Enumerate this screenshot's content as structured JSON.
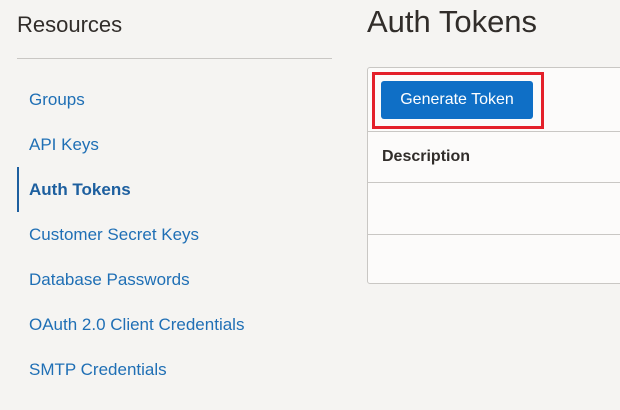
{
  "sidebar": {
    "title": "Resources",
    "items": [
      {
        "label": "Groups"
      },
      {
        "label": "API Keys"
      },
      {
        "label": "Auth Tokens",
        "active": true
      },
      {
        "label": "Customer Secret Keys"
      },
      {
        "label": "Database Passwords"
      },
      {
        "label": "OAuth 2.0 Client Credentials"
      },
      {
        "label": "SMTP Credentials"
      }
    ]
  },
  "main": {
    "title": "Auth Tokens",
    "toolbar": {
      "generate_label": "Generate Token"
    },
    "table": {
      "columns": [
        "Description"
      ],
      "rows": [
        [
          ""
        ],
        [
          ""
        ]
      ]
    }
  },
  "colors": {
    "accent": "#0f6fc6",
    "link": "#1f6fb5",
    "highlight": "#e4202a",
    "background": "#f5f4f2"
  }
}
